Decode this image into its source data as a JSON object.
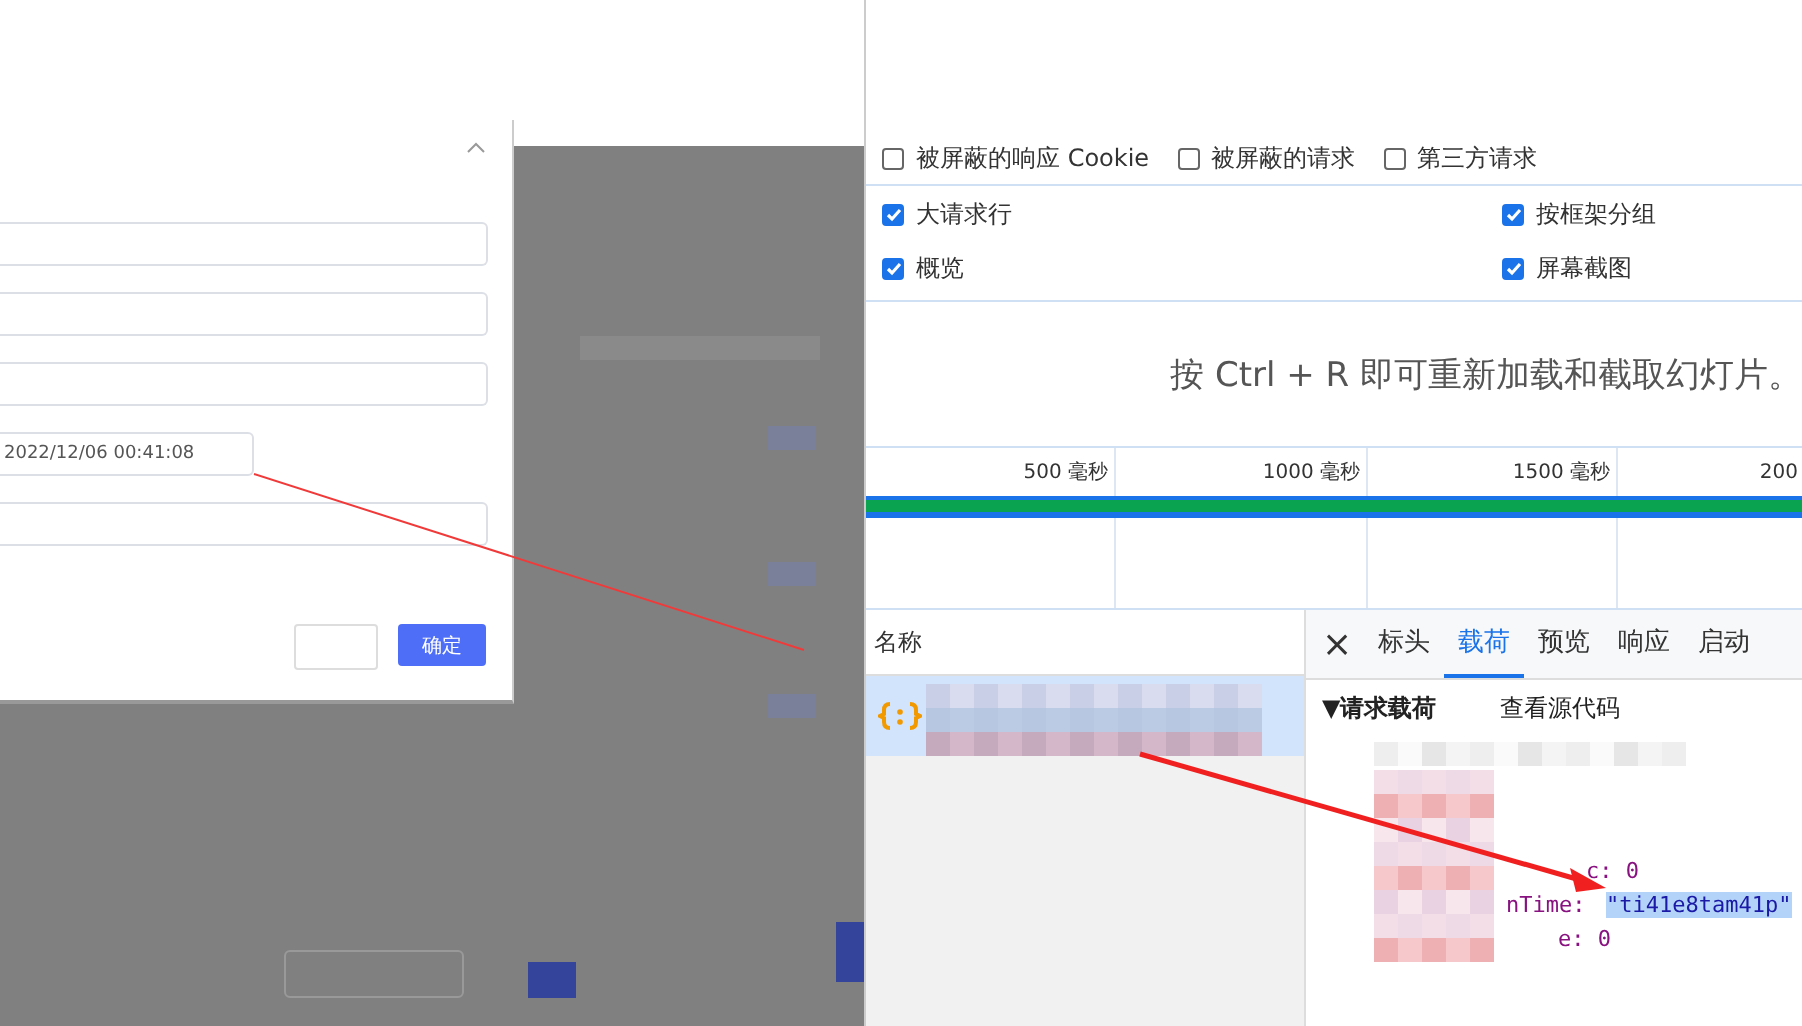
{
  "dialog": {
    "fields": [
      {
        "kind": "input"
      },
      {
        "kind": "input"
      },
      {
        "kind": "input"
      },
      {
        "kind": "date",
        "value": "2022/12/06 00:41:08"
      },
      {
        "kind": "input"
      }
    ],
    "confirm_button": "确定"
  },
  "network": {
    "filters": [
      {
        "label": "被屏蔽的响应 Cookie",
        "checked": false
      },
      {
        "label": "被屏蔽的请求",
        "checked": false
      },
      {
        "label": "第三方请求",
        "checked": false
      }
    ],
    "options": [
      {
        "label": "大请求行",
        "checked": true
      },
      {
        "label": "按框架分组",
        "checked": true
      },
      {
        "label": "概览",
        "checked": true
      },
      {
        "label": "屏幕截图",
        "checked": true
      }
    ],
    "hint": "按 Ctrl + R 即可重新加载和截取幻灯片。",
    "ruler": [
      "500 毫秒",
      "1000 毫秒",
      "1500 毫秒",
      "200"
    ],
    "list_header": "名称",
    "requests": [
      {
        "selected": true
      }
    ],
    "close": "×",
    "detail_tabs": [
      {
        "label": "标头",
        "selected": false
      },
      {
        "label": "载荷",
        "selected": true
      },
      {
        "label": "预览",
        "selected": false
      },
      {
        "label": "响应",
        "selected": false
      },
      {
        "label": "启动",
        "selected": false
      }
    ],
    "section_title": "▼请求载荷",
    "view_source": "查看源代码",
    "payload_lines": [
      {
        "kind": "plain",
        "text": "c: 0"
      },
      {
        "kind": "pair",
        "key": "nTime:",
        "value": "\"ti41e8tam41p\""
      },
      {
        "kind": "plain",
        "text": "e: 0"
      }
    ]
  }
}
